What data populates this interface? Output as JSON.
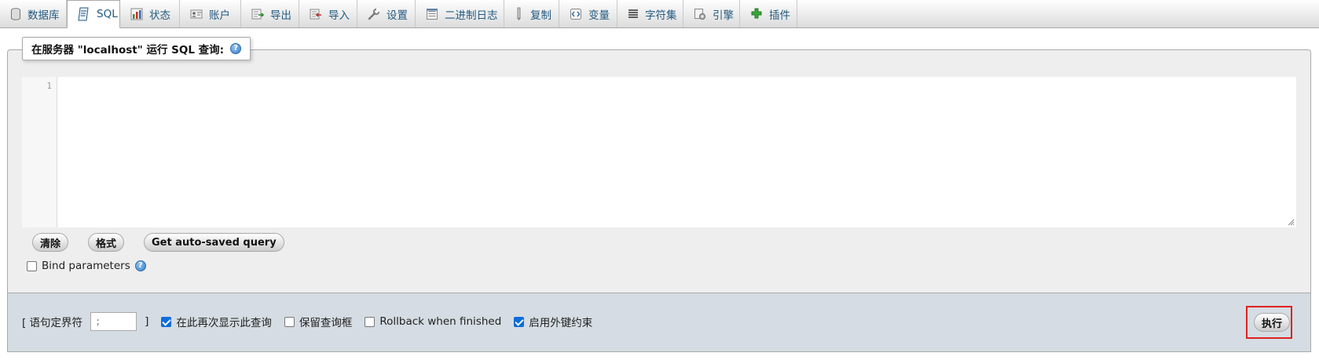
{
  "tabs": [
    {
      "label": "数据库",
      "icon": "database-icon"
    },
    {
      "label": "SQL",
      "icon": "sql-icon",
      "active": true
    },
    {
      "label": "状态",
      "icon": "status-chart-icon"
    },
    {
      "label": "账户",
      "icon": "user-accounts-icon"
    },
    {
      "label": "导出",
      "icon": "export-icon"
    },
    {
      "label": "导入",
      "icon": "import-icon"
    },
    {
      "label": "设置",
      "icon": "wrench-icon"
    },
    {
      "label": "二进制日志",
      "icon": "binary-log-icon"
    },
    {
      "label": "复制",
      "icon": "replication-icon"
    },
    {
      "label": "变量",
      "icon": "variables-icon"
    },
    {
      "label": "字符集",
      "icon": "charset-icon"
    },
    {
      "label": "引擎",
      "icon": "engine-icon"
    },
    {
      "label": "插件",
      "icon": "plugin-icon"
    }
  ],
  "query_panel": {
    "legend": "在服务器 \"localhost\" 运行 SQL 查询:",
    "editor": {
      "line_number": "1",
      "content": ""
    },
    "buttons": {
      "clear": "清除",
      "format": "格式",
      "auto_saved": "Get auto-saved query"
    },
    "bind_parameters": {
      "label": "Bind parameters",
      "checked": false
    }
  },
  "footer": {
    "delimiter_prefix": "[ 语句定界符",
    "delimiter_value": ";",
    "delimiter_suffix": "]",
    "options": [
      {
        "label": "在此再次显示此查询",
        "checked": true
      },
      {
        "label": "保留查询框",
        "checked": false
      },
      {
        "label": "Rollback when finished",
        "checked": false
      },
      {
        "label": "启用外键约束",
        "checked": true
      }
    ],
    "execute": "执行"
  },
  "colors": {
    "tab_text": "#235a81",
    "panel_bg": "#eeeeee",
    "footer_bg": "#d5dce3",
    "highlight": "#e0211f",
    "checkbox": "#0b6cda"
  }
}
